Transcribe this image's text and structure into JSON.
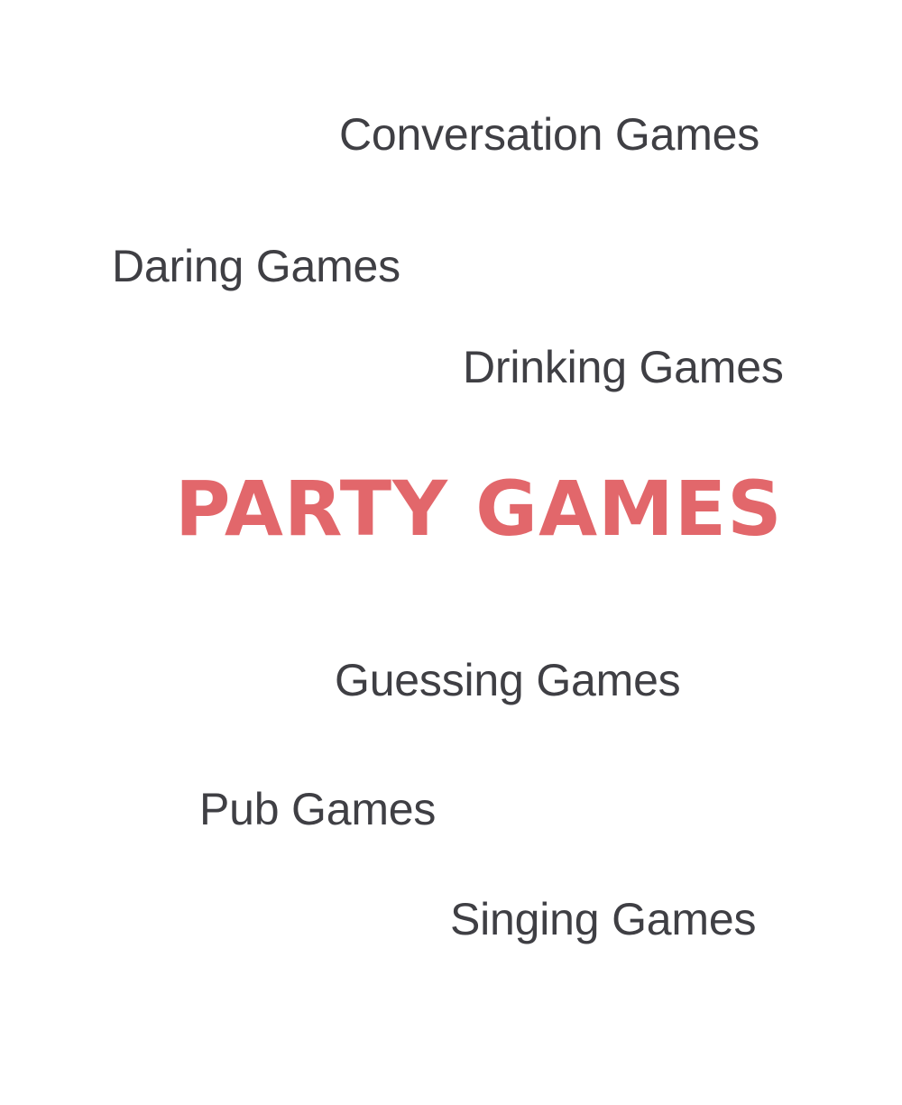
{
  "title": "PARTY GAMES",
  "categories": [
    "Conversation Games",
    "Daring Games",
    "Drinking Games",
    "Guessing Games",
    "Pub Games",
    "Singing Games"
  ],
  "colors": {
    "title": "#e2676b",
    "text": "#3f3f44",
    "background": "#ffffff"
  }
}
